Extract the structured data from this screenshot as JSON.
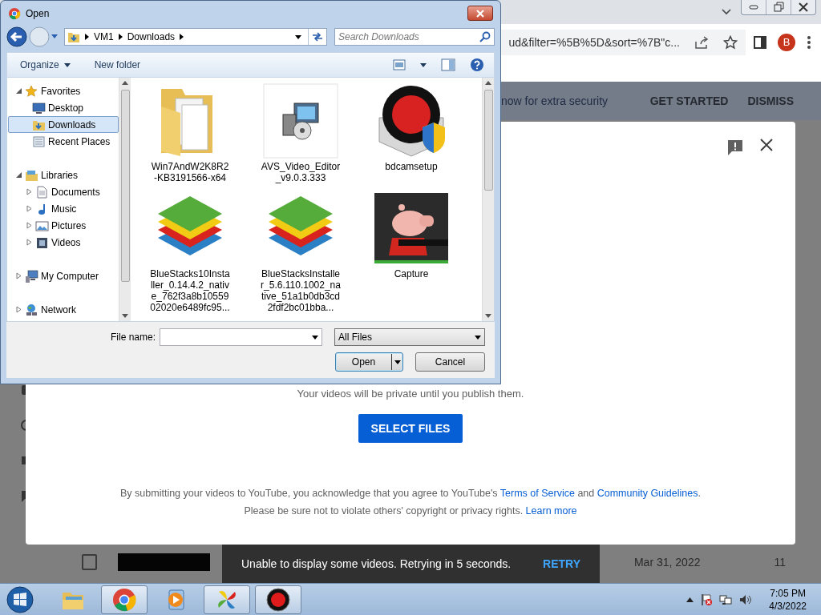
{
  "browser": {
    "url": "ud&filter=%5B%5D&sort=%7B\"c...",
    "avatar": "B",
    "banner": {
      "text": "now for extra security",
      "actions": [
        "GET STARTED",
        "DISMISS"
      ]
    },
    "video_row": {
      "checked": false,
      "date": "Mar 31, 2022",
      "count": "11"
    },
    "snackbar": {
      "message": "Unable to display some videos. Retrying in 5 seconds.",
      "action": "RETRY"
    }
  },
  "upload_modal": {
    "note": "Your videos will be private until you publish them.",
    "button": "SELECT FILES",
    "terms": [
      {
        "text": "By submitting your videos to YouTube, you acknowledge that you agree to YouTube's "
      },
      {
        "text": "Terms of Service",
        "kind": "link"
      },
      {
        "text": " and "
      },
      {
        "text": "Community Guidelines",
        "kind": "link"
      },
      {
        "text": "."
      }
    ],
    "rights": [
      {
        "text": "Please be sure not to violate others' copyright or privacy rights. "
      },
      {
        "text": "Learn more",
        "kind": "link"
      }
    ]
  },
  "open_dialog": {
    "title": "Open",
    "path": [
      "VM1",
      "Downloads"
    ],
    "search_placeholder": "Search Downloads",
    "toolbar": [
      "Organize",
      "New folder"
    ],
    "nav": [
      {
        "label": "Favorites",
        "kind": "star",
        "expanded": true,
        "selected": false,
        "children": [
          {
            "label": "Desktop",
            "kind": "desktop",
            "selected": false
          },
          {
            "label": "Downloads",
            "kind": "download",
            "selected": true
          },
          {
            "label": "Recent Places",
            "kind": "recent",
            "selected": false
          }
        ]
      },
      {
        "label": "Libraries",
        "kind": "library",
        "expanded": true,
        "selected": false,
        "children": [
          {
            "label": "Documents",
            "kind": "document",
            "expanded": false,
            "selected": false
          },
          {
            "label": "Music",
            "kind": "music",
            "expanded": false,
            "selected": false
          },
          {
            "label": "Pictures",
            "kind": "pictures",
            "expanded": false,
            "selected": false
          },
          {
            "label": "Videos",
            "kind": "videos",
            "expanded": false,
            "selected": false
          }
        ]
      },
      {
        "label": "My Computer",
        "kind": "computer",
        "expanded": false,
        "selected": false
      },
      {
        "label": "Network",
        "kind": "network",
        "expanded": false,
        "selected": false
      }
    ],
    "files": [
      {
        "name": "Win7AndW2K8R2-KB3191566-x64",
        "kind": "folder"
      },
      {
        "name": "AVS_Video_Editor_v9.0.3.333",
        "kind": "installer"
      },
      {
        "name": "bdcamsetup",
        "kind": "recorder"
      },
      {
        "name": "BlueStacks10Installer_0.14.4.2_native_762f3a8b1055902020e6489fc95...",
        "kind": "stack"
      },
      {
        "name": "BlueStacksInstaller_5.6.110.1002_native_51a1b0db3cd2fdf2bc01bba...",
        "kind": "stack"
      },
      {
        "name": "Capture",
        "kind": "picture"
      }
    ],
    "file_name_label": "File name:",
    "file_type": "All Files",
    "buttons": [
      "Open",
      "Cancel"
    ]
  },
  "taskbar": {
    "items": [
      {
        "kind": "folder",
        "running": false
      },
      {
        "kind": "browser",
        "running": true
      },
      {
        "kind": "player",
        "running": false
      },
      {
        "kind": "pinwheel",
        "running": true
      },
      {
        "kind": "recorder",
        "running": true
      }
    ],
    "time": "7:05 PM",
    "date": "4/3/2022"
  }
}
